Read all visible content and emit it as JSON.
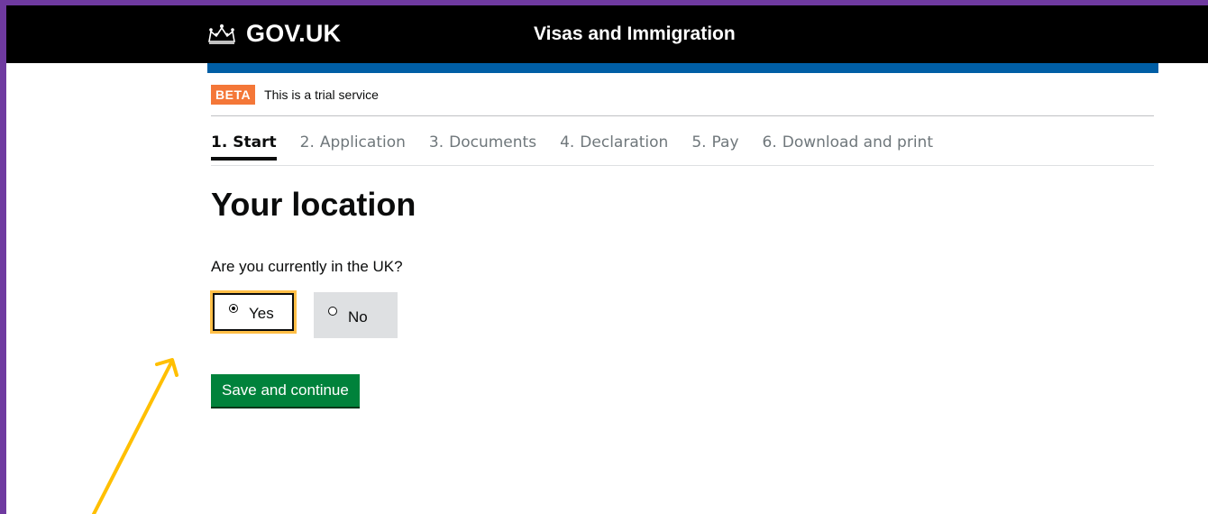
{
  "header": {
    "logo_text": "GOV.UK",
    "service_name": "Visas and Immigration"
  },
  "phase": {
    "tag": "BETA",
    "text": "This is a trial service"
  },
  "steps": [
    {
      "num": "1.",
      "label": "Start",
      "active": true
    },
    {
      "num": "2.",
      "label": "Application",
      "active": false
    },
    {
      "num": "3.",
      "label": "Documents",
      "active": false
    },
    {
      "num": "4.",
      "label": "Declaration",
      "active": false
    },
    {
      "num": "5.",
      "label": "Pay",
      "active": false
    },
    {
      "num": "6.",
      "label": "Download and print",
      "active": false
    }
  ],
  "page": {
    "title": "Your location",
    "question": "Are you currently in the UK?",
    "options": [
      {
        "label": "Yes",
        "selected": true
      },
      {
        "label": "No",
        "selected": false
      }
    ],
    "submit_label": "Save and continue"
  },
  "colors": {
    "header_bg": "#000000",
    "blue_bar": "#005ea5",
    "beta_tag": "#f47738",
    "button_green": "#00823b",
    "focus_outline": "#ffbf47",
    "annotation_arrow": "#ffbf00",
    "frame_border": "#6f3aa0"
  }
}
